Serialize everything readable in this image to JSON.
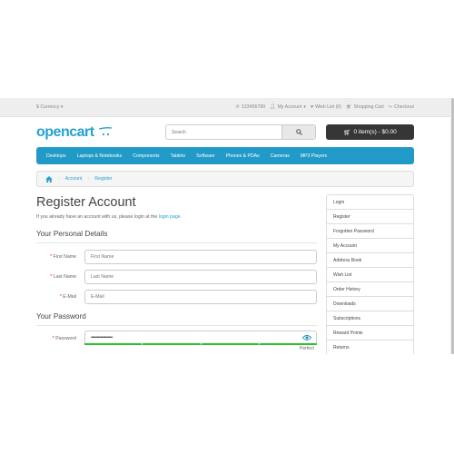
{
  "topbar": {
    "currency": "$ Currency",
    "phone": "123456789",
    "my_account": "My Account",
    "wishlist": "Wish List (0)",
    "shopping_cart": "Shopping Cart",
    "checkout": "Checkout"
  },
  "header": {
    "logo": "opencart",
    "search_placeholder": "Search",
    "cart_button": "0 item(s) - $0.00"
  },
  "menu": [
    "Desktops",
    "Laptops & Notebooks",
    "Components",
    "Tablets",
    "Software",
    "Phones & PDAs",
    "Cameras",
    "MP3 Players"
  ],
  "breadcrumb": {
    "account": "Account",
    "register": "Register"
  },
  "page": {
    "title": "Register Account",
    "intro_prefix": "If you already have an account with us, please login at the",
    "intro_link": "login page.",
    "personal_legend": "Your Personal Details",
    "password_legend": "Your Password",
    "first_name_label": "First Name",
    "first_name_placeholder": "First Name",
    "last_name_label": "Last Name",
    "last_name_placeholder": "Last Name",
    "email_label": "E-Mail",
    "email_placeholder": "E-Mail",
    "password_label": "Password",
    "password_value": "••••••••••••••••••",
    "strength_text": "Perfect",
    "required_mark": "*"
  },
  "sidebar": [
    "Login",
    "Register",
    "Forgotten Password",
    "My Account",
    "Address Book",
    "Wish List",
    "Order History",
    "Downloads",
    "Subscriptions",
    "Reward Points",
    "Returns"
  ],
  "colors": {
    "accent": "#229ac8",
    "link": "#23a1d1",
    "strength": "#29c329",
    "dark_button": "#363636"
  }
}
